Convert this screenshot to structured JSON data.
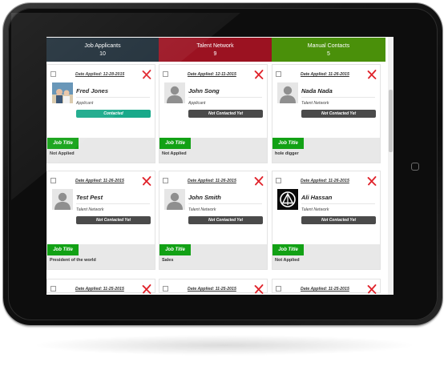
{
  "tabs": [
    {
      "label": "Job Applicants",
      "count": "10"
    },
    {
      "label": "Talent Network",
      "count": "9"
    },
    {
      "label": "Manual Contacts",
      "count": "5"
    }
  ],
  "job_title_label": "Job Title",
  "colors": {
    "tab_applicants": "#1c2b36",
    "tab_talent": "#9b1221",
    "tab_manual": "#4a900a",
    "contacted": "#19a98a",
    "not_contacted": "#4a4a4a",
    "job_title": "#12a115",
    "delete": "#e0232b"
  },
  "cards": [
    {
      "date": "Date Applied: 12-28-2015",
      "name": "Fred Jones",
      "source": "Applicant",
      "status": "Contacted",
      "job_title": "Not Applied",
      "avatar": "photo-avatar"
    },
    {
      "date": "Date Applied: 12-11-2015",
      "name": "John Song",
      "source": "Applicant",
      "status": "Not Contacted Yet",
      "job_title": "Not Applied",
      "avatar": "person-silhouette-icon"
    },
    {
      "date": "Date Applied: 11-26-2015",
      "name": "Nada Nada",
      "source": "Talent Network",
      "status": "Not Contacted Yet",
      "job_title": "hole digger",
      "avatar": "person-silhouette-icon"
    },
    {
      "date": "Date Applied: 11-26-2015",
      "name": "Test Pest",
      "source": "Talent Network",
      "status": "Not Contacted Yet",
      "job_title": "President of the world",
      "avatar": "person-silhouette-icon"
    },
    {
      "date": "Date Applied: 11-26-2015",
      "name": "John Smith",
      "source": "Talent Network",
      "status": "Not Contacted Yet",
      "job_title": "Sales",
      "avatar": "person-silhouette-icon"
    },
    {
      "date": "Date Applied: 11-26-2015",
      "name": "Ali Hassan",
      "source": "Talent Network",
      "status": "Not Contacted Yet",
      "job_title": "Not Applied",
      "avatar": "logo-avatar"
    }
  ],
  "partial_cards": [
    {
      "date": "Date Applied: 11-25-2015"
    },
    {
      "date": "Date Applied: 11-25-2015"
    },
    {
      "date": "Date Applied: 11-25-2015"
    }
  ]
}
